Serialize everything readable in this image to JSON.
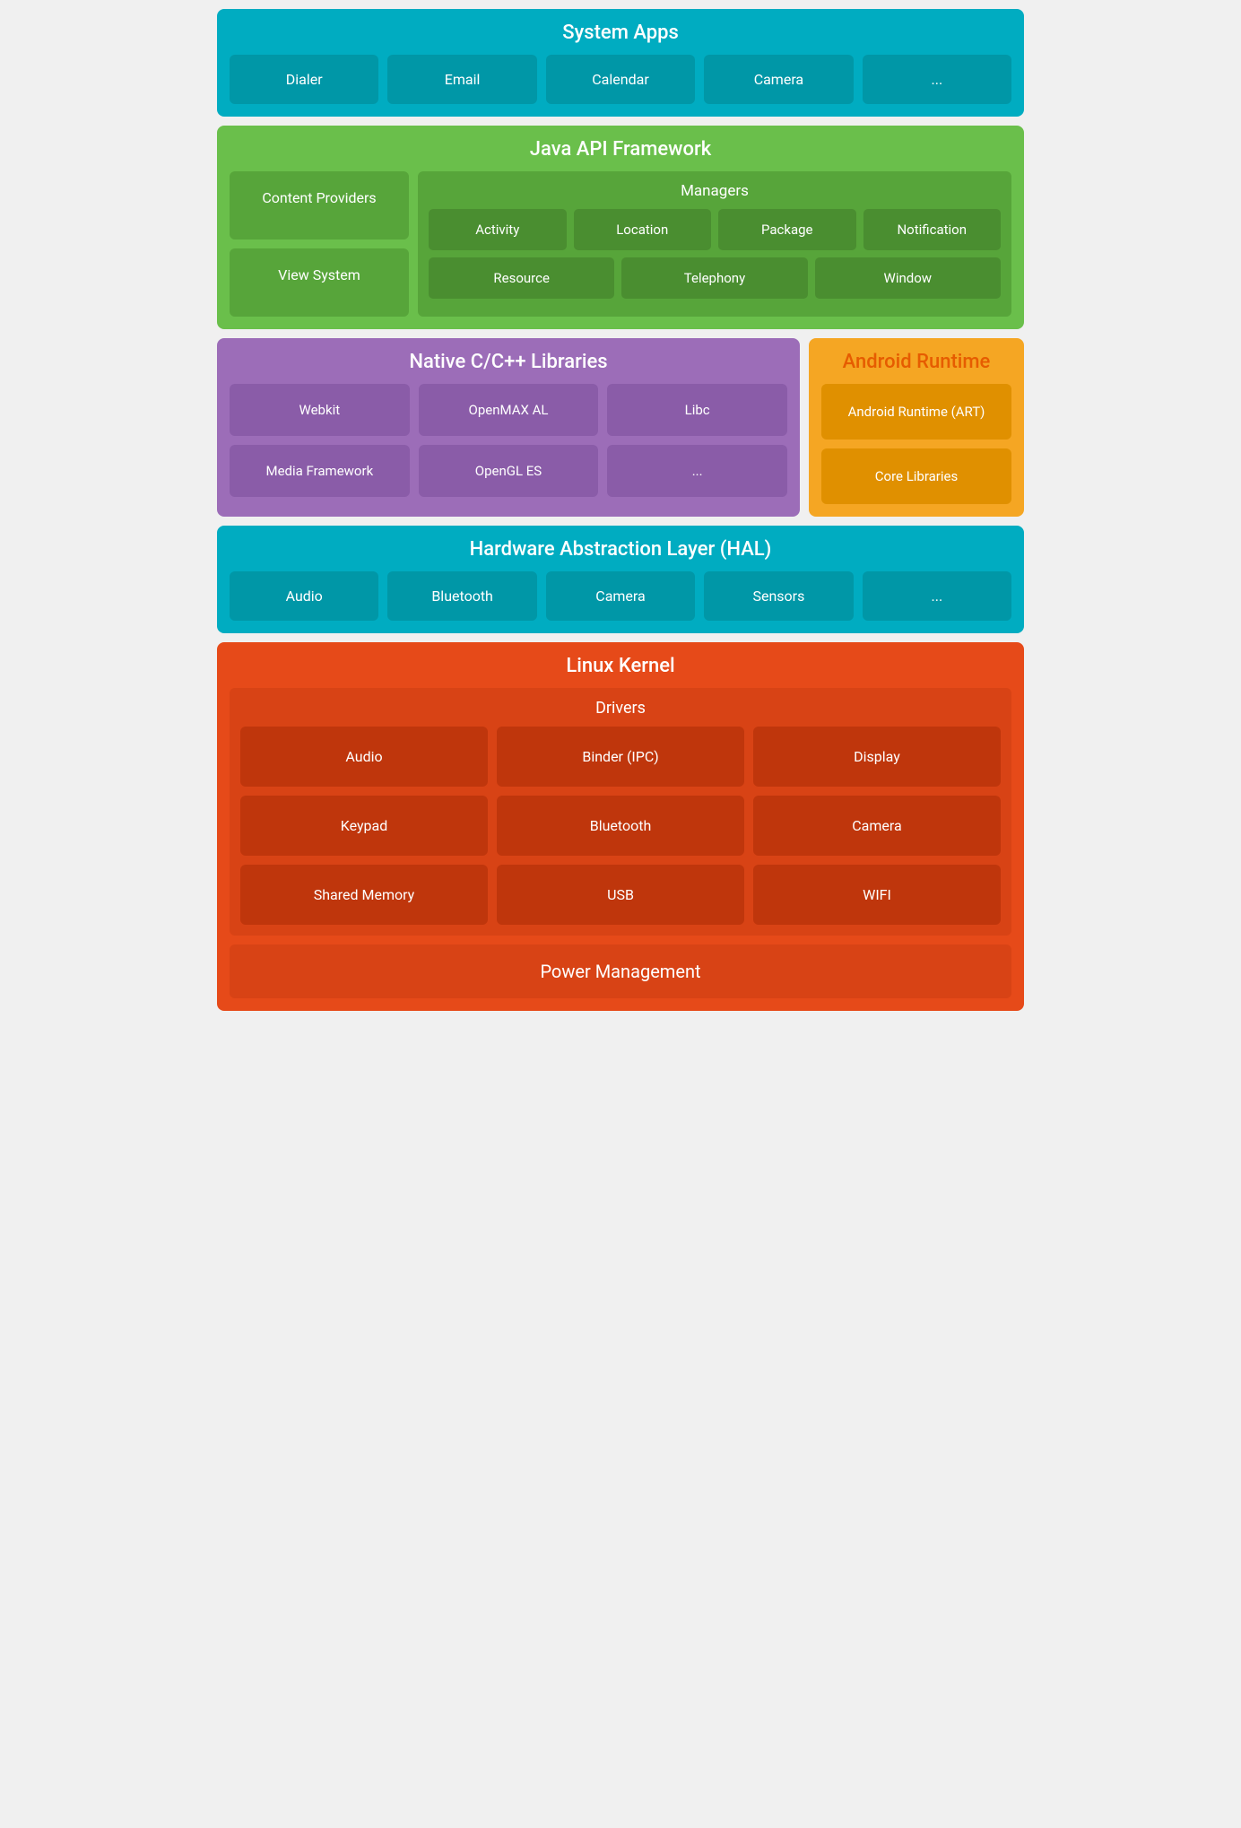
{
  "systemApps": {
    "title": "System Apps",
    "apps": [
      "Dialer",
      "Email",
      "Calendar",
      "Camera",
      "..."
    ]
  },
  "javaAPI": {
    "title": "Java API Framework",
    "left": [
      "Content Providers",
      "View System"
    ],
    "managers": {
      "title": "Managers",
      "row1": [
        "Activity",
        "Location",
        "Package",
        "Notification"
      ],
      "row2": [
        "Resource",
        "Telephony",
        "Window"
      ]
    }
  },
  "nativeLibs": {
    "title": "Native C/C++ Libraries",
    "items": [
      "Webkit",
      "OpenMAX AL",
      "Libc",
      "Media Framework",
      "OpenGL ES",
      "..."
    ]
  },
  "androidRuntime": {
    "title": "Android Runtime",
    "items": [
      "Android Runtime (ART)",
      "Core Libraries"
    ]
  },
  "hal": {
    "title": "Hardware Abstraction Layer (HAL)",
    "items": [
      "Audio",
      "Bluetooth",
      "Camera",
      "Sensors",
      "..."
    ]
  },
  "linuxKernel": {
    "title": "Linux Kernel",
    "drivers": {
      "title": "Drivers",
      "items": [
        "Audio",
        "Binder (IPC)",
        "Display",
        "Keypad",
        "Bluetooth",
        "Camera",
        "Shared Memory",
        "USB",
        "WIFI"
      ]
    },
    "powerManagement": "Power Management"
  }
}
